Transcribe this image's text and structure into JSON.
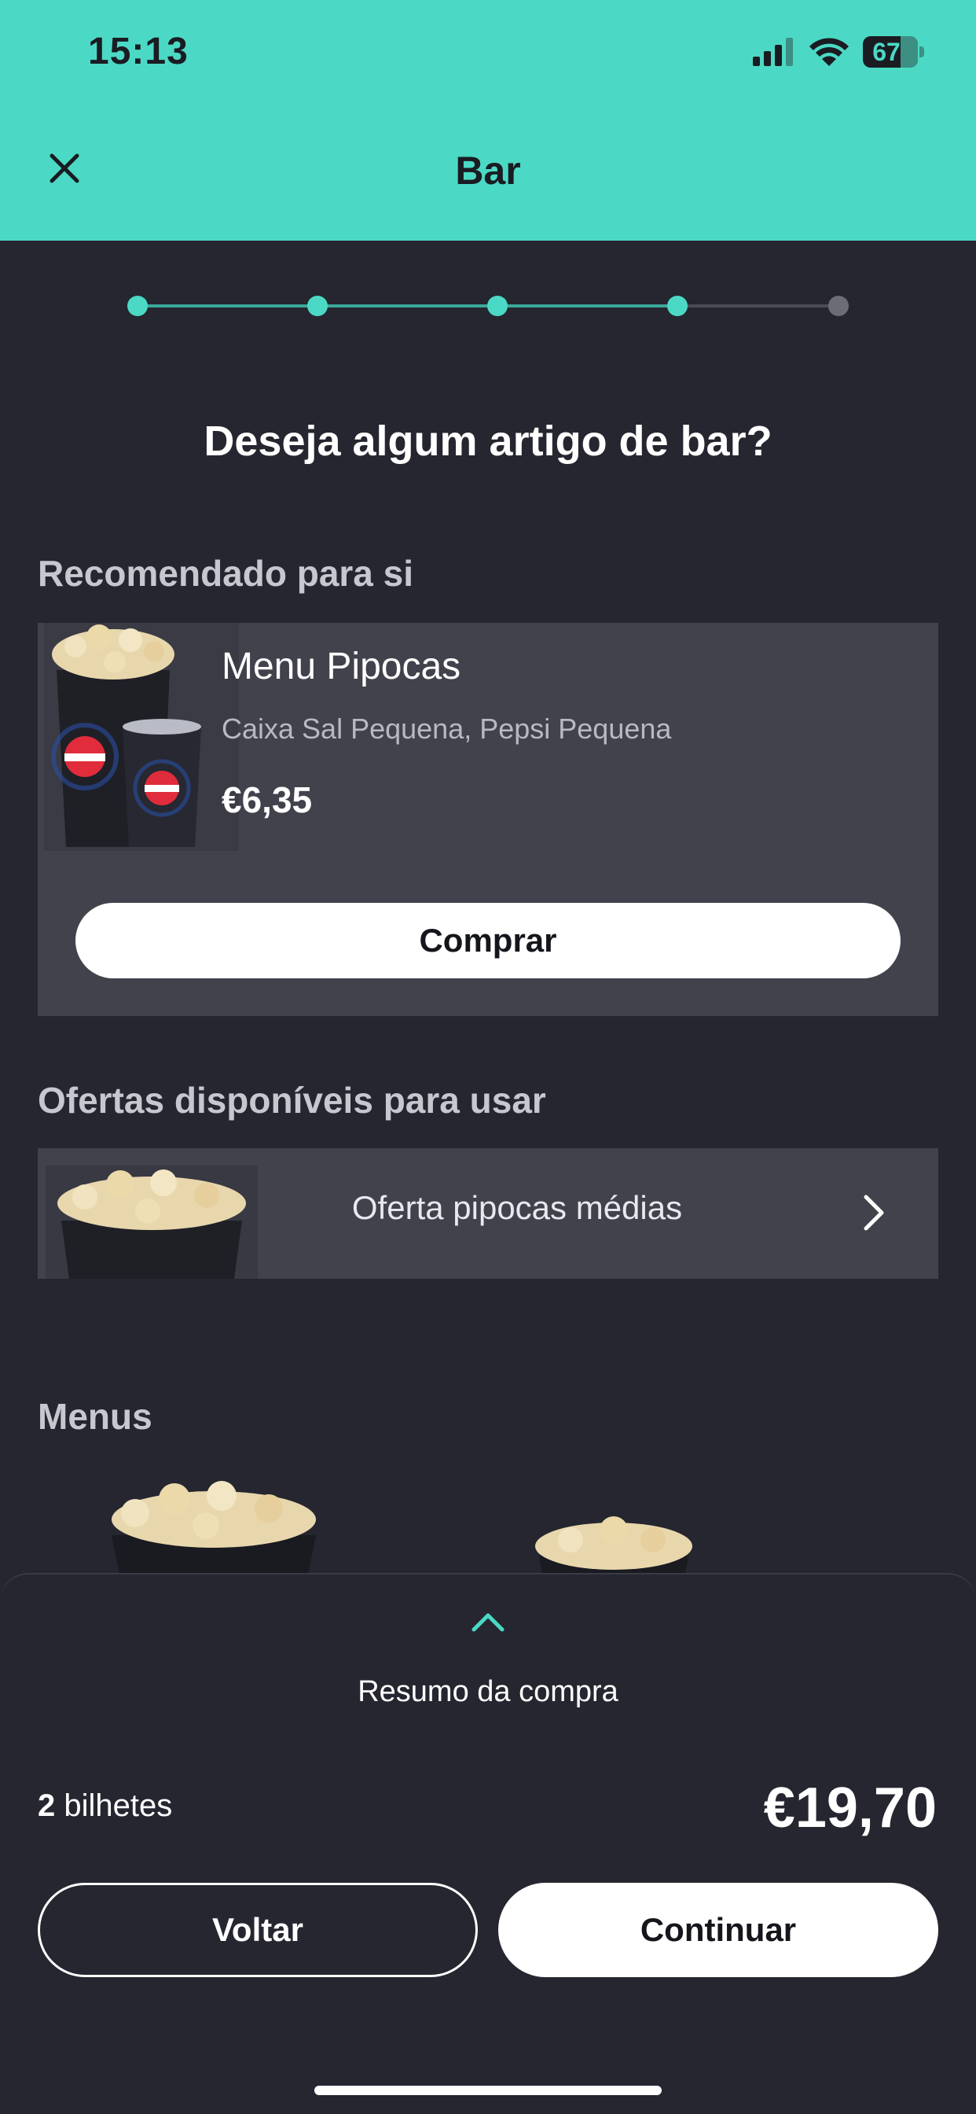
{
  "status_bar": {
    "time": "15:13",
    "battery": "67"
  },
  "header": {
    "title": "Bar",
    "close_icon": "close-icon"
  },
  "stepper": {
    "total_steps": 5,
    "completed_steps": 4,
    "active_color": "#4bd9c5",
    "inactive_color": "#6b6c75"
  },
  "question": "Deseja algum artigo de bar?",
  "recommended": {
    "section_title": "Recomendado para si",
    "item": {
      "name": "Menu Pipocas",
      "description": "Caixa Sal Pequena, Pepsi Pequena",
      "price": "€6,35",
      "buy_label": "Comprar"
    }
  },
  "offers": {
    "section_title": "Ofertas disponíveis para usar",
    "item": {
      "label": "Oferta pipocas médias"
    }
  },
  "menus": {
    "section_title": "Menus"
  },
  "summary": {
    "toggle_icon": "chevron-up-icon",
    "label": "Resumo da compra",
    "tickets_count": "2",
    "tickets_label": " bilhetes",
    "total": "€19,70",
    "back_label": "Voltar",
    "continue_label": "Continuar"
  },
  "colors": {
    "accent": "#4bd9c5",
    "background": "#25262f",
    "card": "#41424c"
  }
}
